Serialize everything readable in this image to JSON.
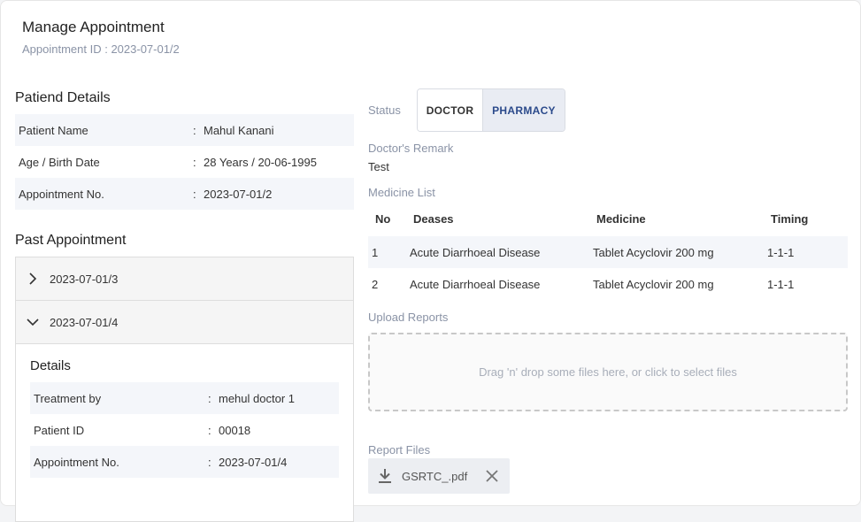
{
  "header": {
    "title": "Manage Appointment",
    "subtitle": "Appointment ID : 2023-07-01/2"
  },
  "patient_details": {
    "title": "Patiend Details",
    "rows": [
      {
        "label": "Patient Name",
        "value": "Mahul Kanani"
      },
      {
        "label": "Age / Birth Date",
        "value": "28 Years / 20-06-1995"
      },
      {
        "label": "Appointment No.",
        "value": "2023-07-01/2"
      }
    ],
    "separator": ":"
  },
  "past_appointment": {
    "title": "Past Appointment",
    "items": [
      {
        "id": "2023-07-01/3",
        "expanded": false,
        "icon": "chevron-right-icon"
      },
      {
        "id": "2023-07-01/4",
        "expanded": true,
        "icon": "chevron-down-icon"
      }
    ],
    "details": {
      "title": "Details",
      "rows": [
        {
          "label": "Treatment by",
          "value": "mehul doctor 1"
        },
        {
          "label": "Patient ID",
          "value": "00018"
        },
        {
          "label": "Appointment No.",
          "value": "2023-07-01/4"
        }
      ]
    }
  },
  "status": {
    "label": "Status",
    "options": [
      "DOCTOR",
      "PHARMACY"
    ],
    "selected": "PHARMACY"
  },
  "remark": {
    "label": "Doctor's Remark",
    "value": "Test"
  },
  "medicine_list": {
    "label": "Medicine List",
    "columns": [
      "No",
      "Deases",
      "Medicine",
      "Timing"
    ],
    "rows": [
      {
        "no": "1",
        "deases": "Acute Diarrhoeal Disease",
        "medicine": "Tablet Acyclovir 200 mg",
        "timing": "1-1-1"
      },
      {
        "no": "2",
        "deases": "Acute Diarrhoeal Disease",
        "medicine": "Tablet Acyclovir 200 mg",
        "timing": "1-1-1"
      }
    ]
  },
  "upload": {
    "label": "Upload Reports",
    "dropzone_text": "Drag 'n' drop some files here, or click to select files"
  },
  "report_files": {
    "label": "Report Files",
    "files": [
      {
        "name": "GSRTC_.pdf",
        "icon": "download-icon"
      }
    ]
  },
  "colors": {
    "accent": "#2b4a8b",
    "muted_text": "#8a93a6",
    "row_shade": "#f4f6fa"
  }
}
